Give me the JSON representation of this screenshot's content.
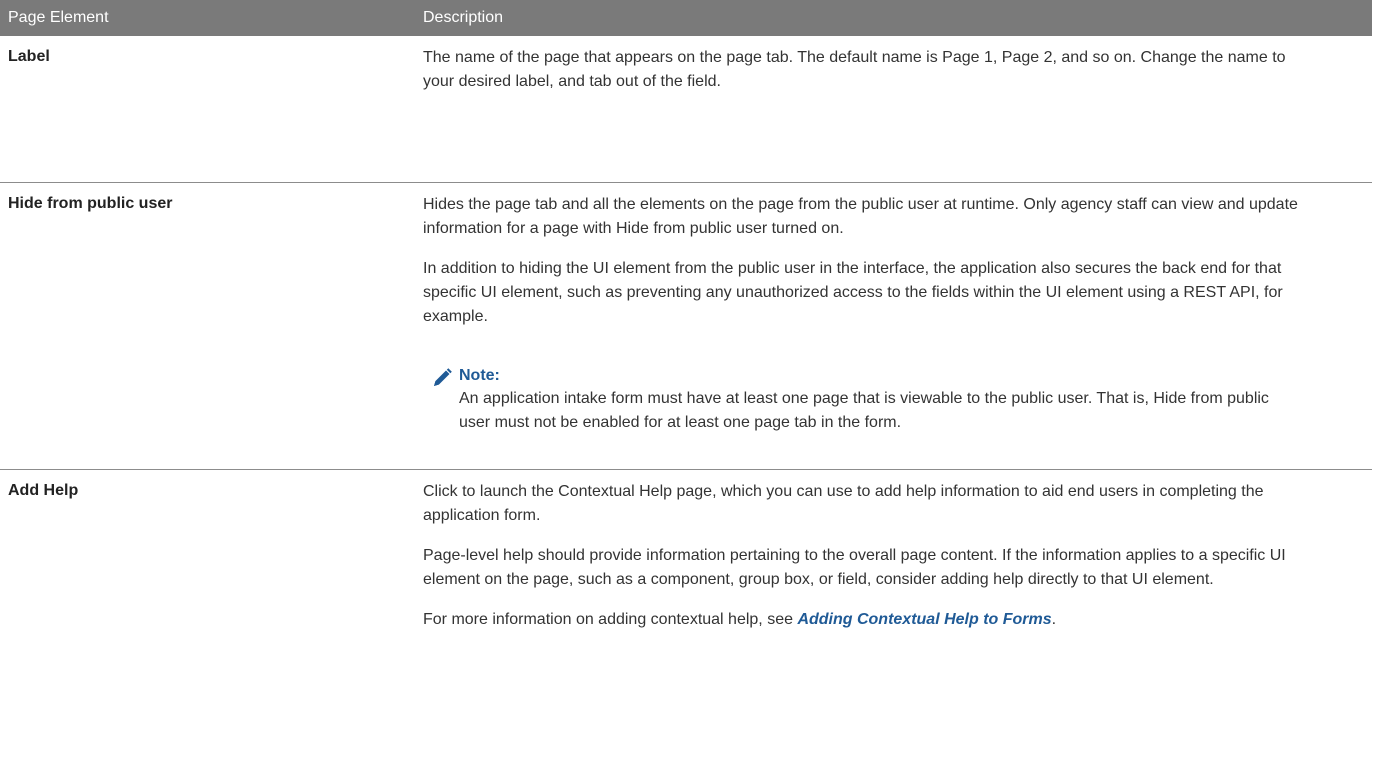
{
  "table": {
    "headers": {
      "page_element": "Page Element",
      "description": "Description"
    },
    "rows": [
      {
        "label": "Label",
        "paragraphs": [
          "The name of the page that appears on the page tab. The default name is Page 1, Page 2, and so on. Change the name to your desired label, and tab out of the field."
        ]
      },
      {
        "label": "Hide from public user",
        "paragraphs": [
          "Hides the page tab and all the elements on the page from the public user at runtime. Only agency staff can view and update information for a page with Hide from public user turned on.",
          "In addition to hiding the UI element from the public user in the interface, the application also secures the back end for that specific UI element, such as preventing any unauthorized access to the fields within the UI element using a REST API, for example."
        ],
        "note": {
          "title": "Note:",
          "text": "An application intake form must have at least one page that is viewable to the public user. That is, Hide from public user must not be enabled for at least one page tab in the form."
        }
      },
      {
        "label": "Add Help",
        "paragraphs": [
          "Click to launch the Contextual Help page, which you can use to add help information to aid end users in completing the application form.",
          "Page-level help should provide information pertaining to the overall page content. If the information applies to a specific UI element on the page, such as a component, group box, or field, consider adding help directly to that UI element."
        ],
        "link_para": {
          "prefix": "For more information on adding contextual help, see ",
          "link_text": "Adding Contextual Help to Forms",
          "suffix": "."
        }
      }
    ]
  },
  "colors": {
    "header_bg": "#7a7a7a",
    "note_blue": "#1f5a96",
    "link_blue": "#1f5a96"
  },
  "icons": {
    "note": "pencil-icon"
  }
}
